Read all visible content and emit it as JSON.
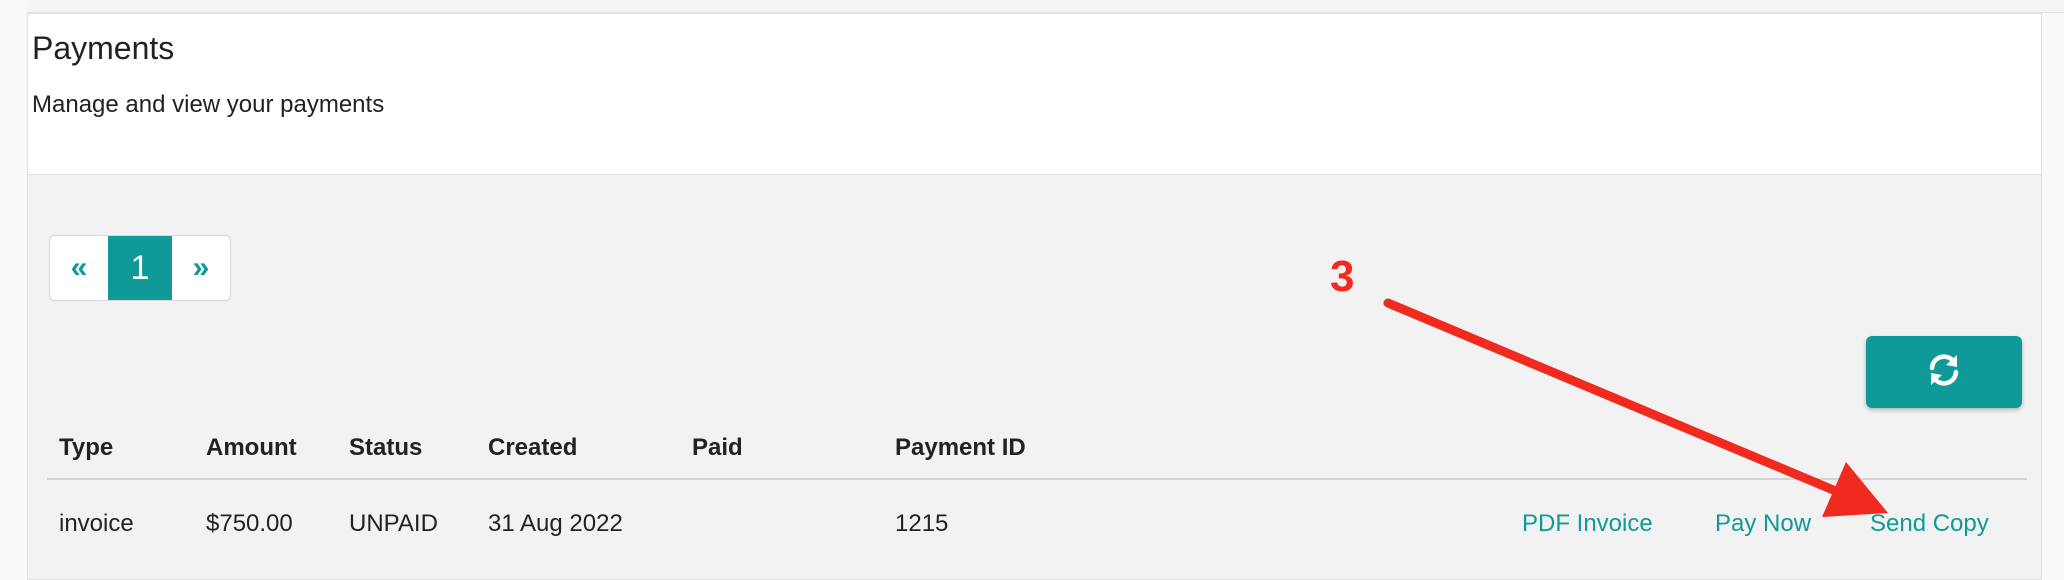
{
  "header": {
    "title": "Payments",
    "subtitle": "Manage and view your payments"
  },
  "pagination": {
    "prev": "«",
    "current": "1",
    "next": "»"
  },
  "refresh": {
    "icon": "refresh-icon"
  },
  "table": {
    "headers": [
      "Type",
      "Amount",
      "Status",
      "Created",
      "Paid",
      "Payment ID"
    ],
    "rows": [
      {
        "type": "invoice",
        "amount": "$750.00",
        "status": "UNPAID",
        "created": "31 Aug 2022",
        "paid": "",
        "payment_id": "1215",
        "actions": [
          "PDF Invoice",
          "Pay Now",
          "Send Copy"
        ]
      }
    ]
  },
  "annotation": {
    "number": "3",
    "color": "#f02a1e"
  },
  "colors": {
    "accent": "#0f9a99"
  }
}
